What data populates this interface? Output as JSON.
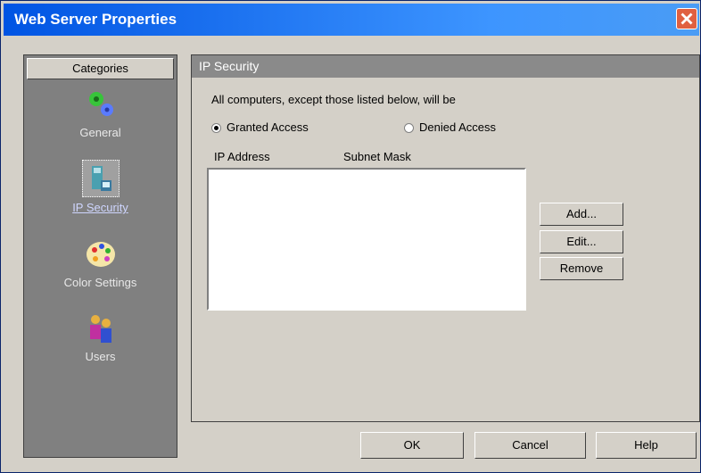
{
  "window": {
    "title": "Web Server Properties"
  },
  "sidebar": {
    "header": "Categories",
    "items": [
      {
        "label": "General",
        "icon": "general-gears-icon"
      },
      {
        "label": "IP Security",
        "icon": "ip-security-icon",
        "selected": true
      },
      {
        "label": "Color Settings",
        "icon": "palette-icon"
      },
      {
        "label": "Users",
        "icon": "users-icon"
      }
    ]
  },
  "panel": {
    "title": "IP Security",
    "description": "All computers, except those listed below, will be",
    "radio_granted": "Granted Access",
    "radio_denied": "Denied Access",
    "selected_radio": "granted",
    "col_ip": "IP Address",
    "col_mask": "Subnet Mask",
    "btn_add": "Add...",
    "btn_edit": "Edit...",
    "btn_remove": "Remove"
  },
  "footer": {
    "ok": "OK",
    "cancel": "Cancel",
    "help": "Help"
  },
  "colors": {
    "title_bar": "#0054e3",
    "dialog_bg": "#d4d0c8",
    "sidebar_bg": "#808080"
  }
}
